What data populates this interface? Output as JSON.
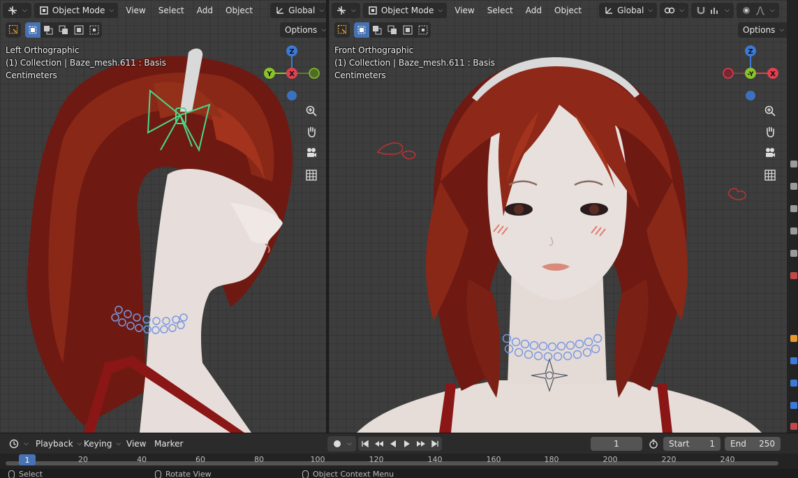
{
  "left_viewport": {
    "header": {
      "mode_label": "Object Mode",
      "menu": [
        "View",
        "Select",
        "Add",
        "Object"
      ],
      "orientation_label": "Global"
    },
    "options_label": "Options",
    "overlay": {
      "view_name": "Left Orthographic",
      "collection": "(1) Collection | Baze_mesh.611 : Basis",
      "units": "Centimeters"
    },
    "gizmo": {
      "top": "Z",
      "left": "Y",
      "center": "X"
    }
  },
  "right_viewport": {
    "header": {
      "mode_label": "Object Mode",
      "menu": [
        "View",
        "Select",
        "Add",
        "Object"
      ],
      "orientation_label": "Global"
    },
    "options_label": "Options",
    "overlay": {
      "view_name": "Front Orthographic",
      "collection": "(1) Collection | Baze_mesh.611 : Basis",
      "units": "Centimeters"
    },
    "gizmo": {
      "top": "Z",
      "center": "-Y",
      "right": "X"
    }
  },
  "colors": {
    "axis_x": "#e0404f",
    "axis_y": "#8ac22a",
    "axis_z": "#3c7ad6",
    "accent": "#4772b3",
    "selection": "#4ad98a"
  },
  "timeline": {
    "playback_label": "Playback",
    "keying_label": "Keying",
    "view_label": "View",
    "marker_label": "Marker",
    "current_frame": "1",
    "start_label": "Start",
    "start_value": "1",
    "end_label": "End",
    "end_value": "250"
  },
  "ruler": {
    "current": "1",
    "ticks": [
      "20",
      "40",
      "60",
      "80",
      "100",
      "120",
      "140",
      "160",
      "180",
      "200",
      "220",
      "240"
    ]
  },
  "status_bar": {
    "select": "Select",
    "rotate": "Rotate View",
    "context": "Object Context Menu"
  }
}
